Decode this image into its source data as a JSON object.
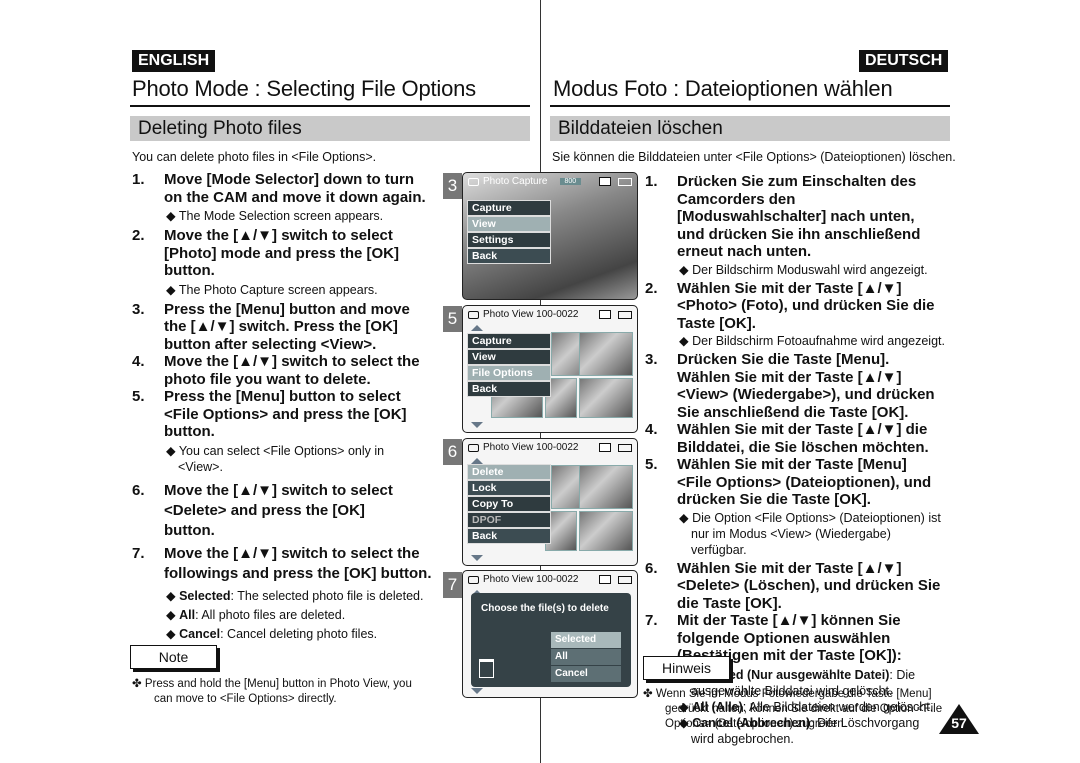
{
  "left": {
    "lang": "ENGLISH",
    "title": "Photo Mode : Selecting File Options",
    "section": "Deleting Photo files",
    "intro": "You can delete photo files in <File Options>.",
    "steps": [
      {
        "n": "1.",
        "text": "Move [Mode Selector] down to turn on the CAM and move it down again.",
        "sub": "◆ The Mode Selection screen appears."
      },
      {
        "n": "2.",
        "text": "Move the [▲/▼] switch to select [Photo] mode and press the [OK] button.",
        "sub": "◆ The Photo Capture screen appears."
      },
      {
        "n": "3.",
        "text": "Press the [Menu] button and move the [▲/▼] switch. Press the [OK] button after selecting <View>."
      },
      {
        "n": "4.",
        "text": "Move the [▲/▼] switch to select the photo file you want to delete."
      },
      {
        "n": "5.",
        "text": "Press the [Menu] button to select <File Options> and press the [OK] button.",
        "sub": "◆ You can select <File Options> only in <View>."
      },
      {
        "n": "6.",
        "text": "Move the [▲/▼] switch to select <Delete> and press the [OK] button."
      },
      {
        "n": "7.",
        "text": "Move the [▲/▼] switch to select the followings and press the [OK] button."
      }
    ],
    "options": [
      {
        "k": "Selected",
        "v": ": The selected photo file is deleted."
      },
      {
        "k": "All",
        "v": ": All photo files are deleted."
      },
      {
        "k": "Cancel",
        "v": ": Cancel deleting photo files."
      }
    ],
    "note_label": "Note",
    "note": "✤ Press and hold the [Menu] button in Photo View, you can move to <File Options> directly."
  },
  "right": {
    "lang": "DEUTSCH",
    "title": "Modus Foto : Dateioptionen wählen",
    "section": "Bilddateien löschen",
    "intro": "Sie können die Bilddateien unter <File Options> (Dateioptionen) löschen.",
    "steps": [
      {
        "n": "1.",
        "text": "Drücken Sie zum Einschalten des Camcorders den [Moduswahlschalter] nach unten, und drücken Sie ihn anschließend erneut nach unten.",
        "sub": "◆ Der Bildschirm Moduswahl wird angezeigt."
      },
      {
        "n": "2.",
        "text": "Wählen Sie mit der Taste [▲/▼] <Photo> (Foto), und drücken Sie die Taste [OK].",
        "sub": "◆ Der Bildschirm Fotoaufnahme wird angezeigt."
      },
      {
        "n": "3.",
        "text": "Drücken Sie die Taste [Menu]. Wählen Sie  mit der Taste [▲/▼] <View> (Wiedergabe>), und drücken Sie anschließend die Taste [OK]."
      },
      {
        "n": "4.",
        "text": "Wählen Sie mit der Taste [▲/▼] die Bilddatei, die Sie löschen möchten."
      },
      {
        "n": "5.",
        "text": "Wählen Sie mit der Taste [Menu] <File Options> (Dateioptionen), und drücken Sie die Taste [OK].",
        "sub": "◆ Die Option <File Options> (Dateioptionen) ist nur im Modus <View> (Wiedergabe) verfügbar."
      },
      {
        "n": "6.",
        "text": "Wählen Sie mit der Taste [▲/▼] <Delete> (Löschen), und drücken Sie die Taste [OK]."
      },
      {
        "n": "7.",
        "text": "Mit der Taste [▲/▼] können Sie folgende Optionen auswählen (Bestätigen mit der Taste [OK]):"
      }
    ],
    "options": [
      {
        "k": "Selected (Nur ausgewählte Datei)",
        "v": ": Die ausgewählte Bilddatei wird gelöscht."
      },
      {
        "k": "All (Alle)",
        "v": ": Alle Bilddateien werden gelöscht."
      },
      {
        "k": "Cancel (Abbrechen)",
        "v": ": Der Löschvorgang wird abgebrochen."
      }
    ],
    "note_label": "Hinweis",
    "note": "✤ Wenn Sie im Modus Fotowiedergabe die Taste [Menu] gedrückt halten, können Sie direkt auf die Option <File Options> (Dateioptionen) zugreifen."
  },
  "screens": [
    {
      "num": "3",
      "title": "Photo Capture",
      "badge": "800",
      "menu": [
        "Capture",
        "View",
        "Settings",
        "Back"
      ],
      "selected": 1
    },
    {
      "num": "5",
      "title": "Photo View  100-0022",
      "menu": [
        "Capture",
        "View",
        "File Options",
        "Back"
      ],
      "selected": 2
    },
    {
      "num": "6",
      "title": "Photo View  100-0022",
      "menu": [
        "Delete",
        "Lock",
        "Copy To",
        "DPOF",
        "Back"
      ],
      "selected": 0,
      "disabled": 3
    },
    {
      "num": "7",
      "title": "Photo View  100-0022",
      "dialog": "Choose the file(s) to delete",
      "options": [
        "Selected",
        "All",
        "Cancel"
      ],
      "selected": 0
    }
  ],
  "page_number": "57"
}
